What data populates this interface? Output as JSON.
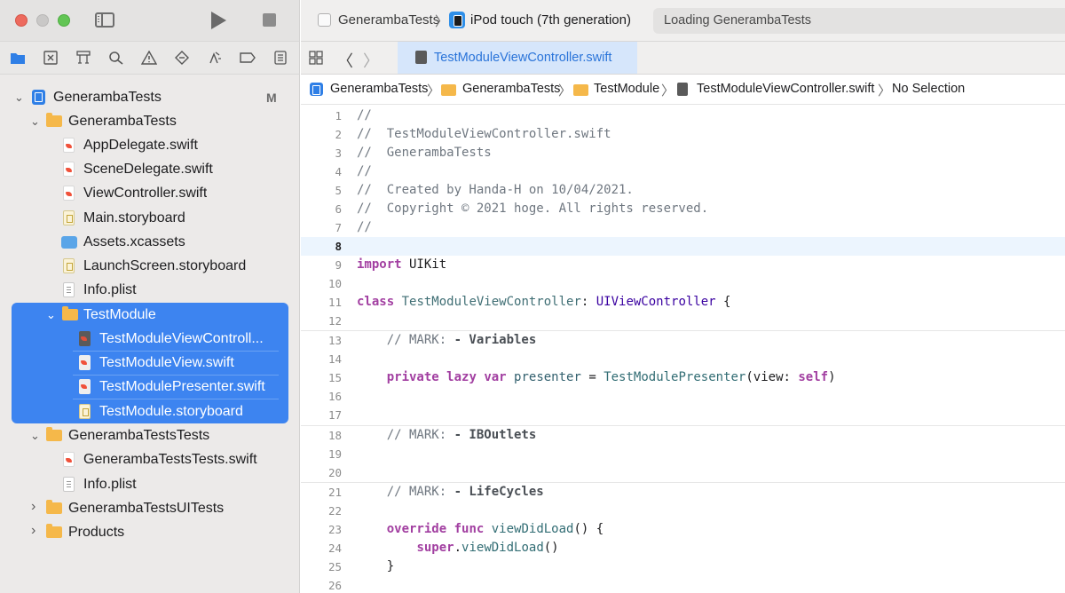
{
  "toolbar": {
    "scheme": "GenerambaTests",
    "scheme_chevron": "〉",
    "device": "iPod touch (7th generation)",
    "status": "Loading GenerambaTests"
  },
  "tab": {
    "label": "TestModuleViewController.swift"
  },
  "nav": {
    "back": "〈",
    "forward": "〉"
  },
  "navigator_icons": [
    "folder-icon",
    "source-control-icon",
    "hierarchy-icon",
    "search-icon",
    "warning-icon",
    "test-icon",
    "debug-icon",
    "breakpoint-icon",
    "report-icon"
  ],
  "sidebar": {
    "modified_badge": "M",
    "items": [
      {
        "label": "GenerambaTests",
        "icon": "project-icon",
        "chevron": "⌄"
      },
      {
        "label": "GenerambaTests",
        "icon": "folder-icon",
        "chevron": "⌄"
      },
      {
        "label": "AppDelegate.swift",
        "icon": "swift-file-icon"
      },
      {
        "label": "SceneDelegate.swift",
        "icon": "swift-file-icon"
      },
      {
        "label": "ViewController.swift",
        "icon": "swift-file-icon"
      },
      {
        "label": "Main.storyboard",
        "icon": "storyboard-icon"
      },
      {
        "label": "Assets.xcassets",
        "icon": "assets-icon"
      },
      {
        "label": "LaunchScreen.storyboard",
        "icon": "storyboard-icon"
      },
      {
        "label": "Info.plist",
        "icon": "plist-icon"
      },
      {
        "label": "TestModule",
        "icon": "folder-icon",
        "chevron": "⌄"
      },
      {
        "label": "TestModuleViewControll...",
        "icon": "swift-file-icon"
      },
      {
        "label": "TestModuleView.swift",
        "icon": "swift-file-icon"
      },
      {
        "label": "TestModulePresenter.swift",
        "icon": "swift-file-icon"
      },
      {
        "label": "TestModule.storyboard",
        "icon": "storyboard-icon"
      },
      {
        "label": "GenerambaTestsTests",
        "icon": "folder-icon",
        "chevron": "⌄"
      },
      {
        "label": "GenerambaTestsTests.swift",
        "icon": "swift-file-icon"
      },
      {
        "label": "Info.plist",
        "icon": "plist-icon"
      },
      {
        "label": "GenerambaTestsUITests",
        "icon": "folder-icon",
        "chevron": "›"
      },
      {
        "label": "Products",
        "icon": "folder-icon",
        "chevron": "›"
      }
    ]
  },
  "breadcrumb": {
    "items": [
      "GenerambaTests",
      "GenerambaTests",
      "TestModule",
      "TestModuleViewController.swift",
      "No Selection"
    ],
    "separator": "〉"
  },
  "editor": {
    "current_line": 8,
    "lines": [
      {
        "n": "1",
        "t": "//"
      },
      {
        "n": "2",
        "t": "//  TestModuleViewController.swift"
      },
      {
        "n": "3",
        "t": "//  GenerambaTests"
      },
      {
        "n": "4",
        "t": "//"
      },
      {
        "n": "5",
        "t": "//  Created by Handa-H on 10/04/2021."
      },
      {
        "n": "6",
        "t": "//  Copyright © 2021 hoge. All rights reserved."
      },
      {
        "n": "7",
        "t": "//"
      },
      {
        "n": "8",
        "t": ""
      },
      {
        "n": "9",
        "kw": "import",
        "rest": " UIKit"
      },
      {
        "n": "10",
        "t": ""
      },
      {
        "n": "11",
        "kw": "class",
        "name": " TestModuleViewController",
        "colon": ": ",
        "super": "UIViewController",
        "brace": " {"
      },
      {
        "n": "12",
        "t": ""
      },
      {
        "n": "13",
        "indent": "    ",
        "comment": "// MARK: ",
        "mark": "- Variables"
      },
      {
        "n": "14",
        "t": ""
      },
      {
        "n": "15",
        "indent": "    ",
        "kw1": "private",
        "kw2": " lazy",
        "kw3": " var",
        "ident": " presenter",
        "eq": " = ",
        "call": "TestModulePresenter",
        "args": "(view: ",
        "selfkw": "self",
        "close": ")"
      },
      {
        "n": "16",
        "t": ""
      },
      {
        "n": "17",
        "t": ""
      },
      {
        "n": "18",
        "indent": "    ",
        "comment": "// MARK: ",
        "mark": "- IBOutlets"
      },
      {
        "n": "19",
        "t": ""
      },
      {
        "n": "20",
        "t": ""
      },
      {
        "n": "21",
        "indent": "    ",
        "comment": "// MARK: ",
        "mark": "- LifeCycles"
      },
      {
        "n": "22",
        "t": ""
      },
      {
        "n": "23",
        "indent": "    ",
        "kw1": "override",
        "kw2": " func",
        "fn": " viewDidLoad",
        "tail": "() {"
      },
      {
        "n": "24",
        "indent": "        ",
        "superkw": "super",
        "dot": ".",
        "fn": "viewDidLoad",
        "tail": "()"
      },
      {
        "n": "25",
        "indent": "    ",
        "t": "}"
      },
      {
        "n": "26",
        "t": ""
      }
    ]
  }
}
